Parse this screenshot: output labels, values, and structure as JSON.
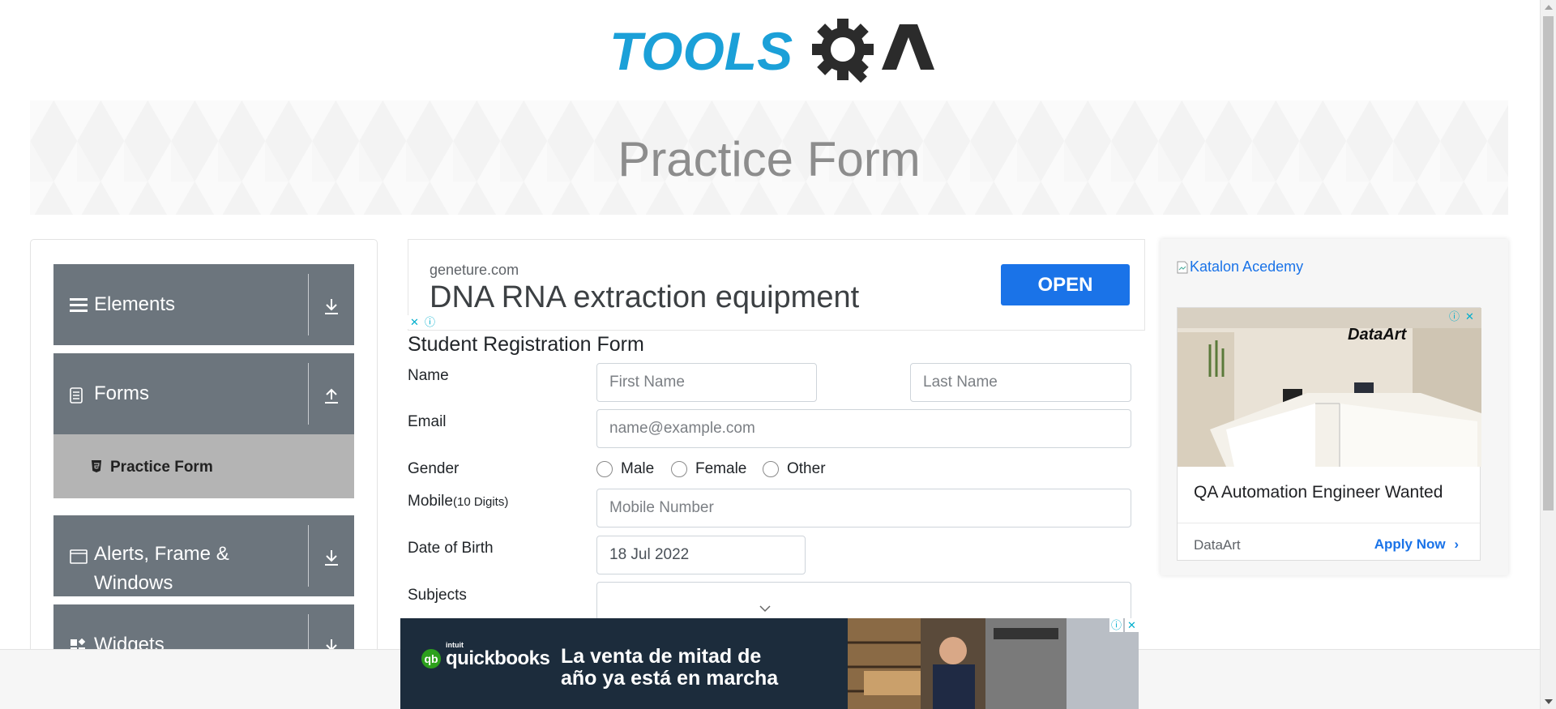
{
  "logo": {
    "text_left": "TOOLS",
    "text_right": "QA",
    "alt": "ToolsQA logo"
  },
  "banner": {
    "title": "Practice Form"
  },
  "leftnav": {
    "groups": [
      {
        "label": "Elements",
        "expanded": false
      },
      {
        "label": "Forms",
        "expanded": true
      },
      {
        "label": "Alerts, Frame &",
        "label2": "Windows",
        "expanded": false
      },
      {
        "label": "Widgets",
        "expanded": false
      }
    ],
    "active_item": "Practice Form"
  },
  "ad_top": {
    "domain": "geneture.com",
    "headline": "DNA RNA extraction equipment",
    "cta": "OPEN"
  },
  "form": {
    "title": "Student Registration Form",
    "name_label": "Name",
    "first_name_placeholder": "First Name",
    "last_name_placeholder": "Last Name",
    "email_label": "Email",
    "email_placeholder": "name@example.com",
    "gender_label": "Gender",
    "gender_options": [
      "Male",
      "Female",
      "Other"
    ],
    "mobile_label": "Mobile",
    "mobile_hint": "(10 Digits)",
    "mobile_placeholder": "Mobile Number",
    "dob_label": "Date of Birth",
    "dob_value": "18 Jul 2022",
    "subjects_label": "Subjects"
  },
  "ad_right": {
    "broken_image_alt": "Katalon Acedemy",
    "brand": "DataArt",
    "headline": "QA Automation Engineer Wanted",
    "advertiser": "DataArt",
    "cta": "Apply Now"
  },
  "ad_bottom": {
    "brand_prefix": "intuit",
    "brand": "quickbooks",
    "line1": "La venta de mitad de",
    "line2": "año ya está en marcha"
  },
  "colors": {
    "nav_group": "#6c757d",
    "nav_active": "#b4b4b4",
    "logo_blue": "#1ba0d8",
    "logo_dark": "#2b2b2b",
    "cta_blue": "#1a73e8"
  }
}
